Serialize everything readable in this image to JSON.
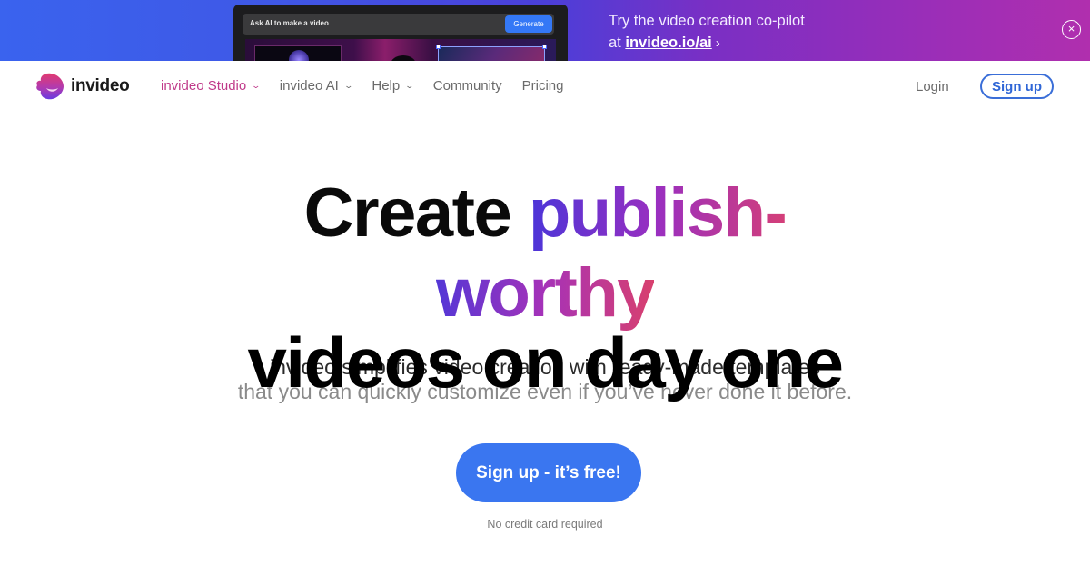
{
  "banner": {
    "mock": {
      "input_placeholder": "Ask AI to make a video",
      "generate_label": "Generate"
    },
    "text_line1": "Try the video creation co-pilot",
    "text_prefix": "at ",
    "link_text": "invideo.io/ai",
    "chevron": "›",
    "close_icon": "×"
  },
  "nav": {
    "brand": "invideo",
    "links": [
      {
        "label": "invideo Studio",
        "has_dropdown": true,
        "active": true
      },
      {
        "label": "invideo AI",
        "has_dropdown": true,
        "active": false
      },
      {
        "label": "Help",
        "has_dropdown": true,
        "active": false
      },
      {
        "label": "Community",
        "has_dropdown": false,
        "active": false
      },
      {
        "label": "Pricing",
        "has_dropdown": false,
        "active": false
      }
    ],
    "chevron": "⌄",
    "login_label": "Login",
    "signup_label": "Sign up"
  },
  "hero": {
    "title_part1": "Create ",
    "title_part2": "publish-",
    "title_line2": "worthy",
    "title_line3": "videos on day one",
    "subtitle_line1": "invideo simplifies video creation with ready-made templates",
    "subtitle_line2": "that you can quickly customize even if you’ve never done it before.",
    "cta_label": "Sign up - it’s free!",
    "cta_note": "No credit card required"
  },
  "colors": {
    "accent_blue": "#3a76f0",
    "nav_active": "#c03a8a",
    "gradient_start": "#4b35d8",
    "gradient_end": "#d43f78"
  }
}
